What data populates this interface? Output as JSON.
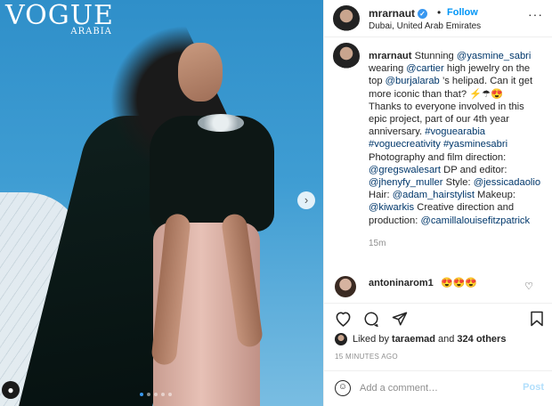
{
  "photo": {
    "brand": "VOGUE",
    "brand_sub": "ARABIA",
    "dots_count": 5,
    "active_dot": 0
  },
  "header": {
    "username": "mrarnaut",
    "follow_separator": "•",
    "follow_label": "Follow",
    "location": "Dubai, United Arab Emirates",
    "more_label": "···"
  },
  "caption": {
    "username": "mrarnaut",
    "parts": [
      {
        "t": "Stunning ",
        "link": false
      },
      {
        "t": "@yasmine_sabri",
        "link": true
      },
      {
        "t": " wearing ",
        "link": false
      },
      {
        "t": "@cartier",
        "link": true
      },
      {
        "t": " high jewelry on the top ",
        "link": false
      },
      {
        "t": "@burjalarab",
        "link": true
      },
      {
        "t": " ’s helipad. Can it get more iconic than that? ⚡☂😍",
        "link": false
      },
      {
        "t": "\nThanks to everyone involved in this epic project, part of our 4th year anniversary. ",
        "link": false
      },
      {
        "t": "#voguearabia",
        "link": true
      },
      {
        "t": "\n",
        "link": false
      },
      {
        "t": "#voguecreativity",
        "link": true
      },
      {
        "t": " ",
        "link": false
      },
      {
        "t": "#yasminesabri",
        "link": true
      },
      {
        "t": "\nPhotography and film direction: ",
        "link": false
      },
      {
        "t": "@gregswalesart",
        "link": true
      },
      {
        "t": " DP and editor: ",
        "link": false
      },
      {
        "t": "@jhenyfy_muller",
        "link": true
      },
      {
        "t": " Style: ",
        "link": false
      },
      {
        "t": "@jessicadaolio",
        "link": true
      },
      {
        "t": " Hair: ",
        "link": false
      },
      {
        "t": "@adam_hairstylist",
        "link": true
      },
      {
        "t": " Makeup: ",
        "link": false
      },
      {
        "t": "@kiwarkis",
        "link": true
      },
      {
        "t": " Creative direction and production: ",
        "link": false
      },
      {
        "t": "@camillalouisefitzpatrick",
        "link": true
      }
    ],
    "time": "15m"
  },
  "comment": {
    "username": "antoninarom1",
    "text": "😍😍😍"
  },
  "actions": {
    "like_icon": "heart-icon",
    "comment_icon": "comment-icon",
    "share_icon": "share-icon",
    "save_icon": "bookmark-icon"
  },
  "likes": {
    "prefix": "Liked by ",
    "user": "taraemad",
    "middle": " and ",
    "others": "324 others"
  },
  "timestamp": "15 MINUTES AGO",
  "add_comment": {
    "placeholder": "Add a comment…",
    "post_label": "Post"
  },
  "colors": {
    "accent": "#0095f6",
    "link": "#00376b",
    "post_disabled": "#b2dffc"
  }
}
